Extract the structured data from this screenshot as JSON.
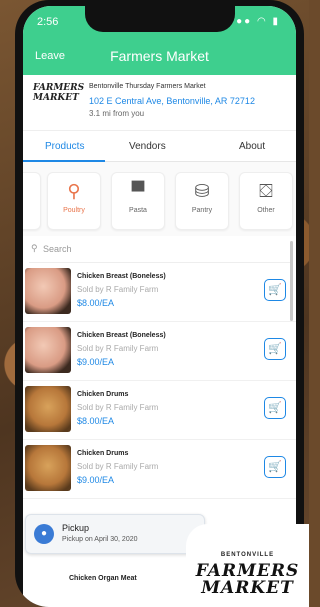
{
  "status": {
    "time": "2:56",
    "icons": "●● ◠ ▮"
  },
  "header": {
    "leave_label": "Leave",
    "title": "Farmers Market"
  },
  "market": {
    "logo_line1": "FARMERS",
    "logo_line2": "MARKET",
    "name": "Bentonville Thursday Farmers Market",
    "address": "102 E Central Ave, Bentonville, AR 72712",
    "distance": "3.1 mi from you"
  },
  "tabs": [
    "Products",
    "Vendors",
    "About"
  ],
  "categories": [
    {
      "label": "Poultry",
      "icon": "drumstick-icon",
      "glyph": "⚲"
    },
    {
      "label": "Pasta",
      "icon": "pasta-icon",
      "glyph": "▀"
    },
    {
      "label": "Pantry",
      "icon": "jar-icon",
      "glyph": "⛁"
    },
    {
      "label": "Other",
      "icon": "basket-icon",
      "glyph": "⛋"
    }
  ],
  "search": {
    "placeholder": "Search",
    "icon": "search-icon"
  },
  "products": [
    {
      "name": "Chicken Breast (Boneless)",
      "vendor": "Sold by R Family Farm",
      "price": "$8.00/EA",
      "thumb": "breast"
    },
    {
      "name": "Chicken Breast (Boneless)",
      "vendor": "Sold by R Family Farm",
      "price": "$9.00/EA",
      "thumb": "breast"
    },
    {
      "name": "Chicken Drums",
      "vendor": "Sold by R Family Farm",
      "price": "$8.00/EA",
      "thumb": "drum"
    },
    {
      "name": "Chicken Drums",
      "vendor": "Sold by R Family Farm",
      "price": "$9.00/EA",
      "thumb": "drum"
    }
  ],
  "pickup": {
    "title": "Pickup",
    "subtitle": "Pickup on April 30, 2020"
  },
  "last_item": "Chicken Organ Meat",
  "corner_logo": {
    "top": "BENTONVILLE",
    "line1": "FARMERS",
    "line2": "MARKET"
  },
  "colors": {
    "header_green": "#3ecf8e",
    "accent_blue": "#1e88e5",
    "active_orange": "#e9744a"
  }
}
